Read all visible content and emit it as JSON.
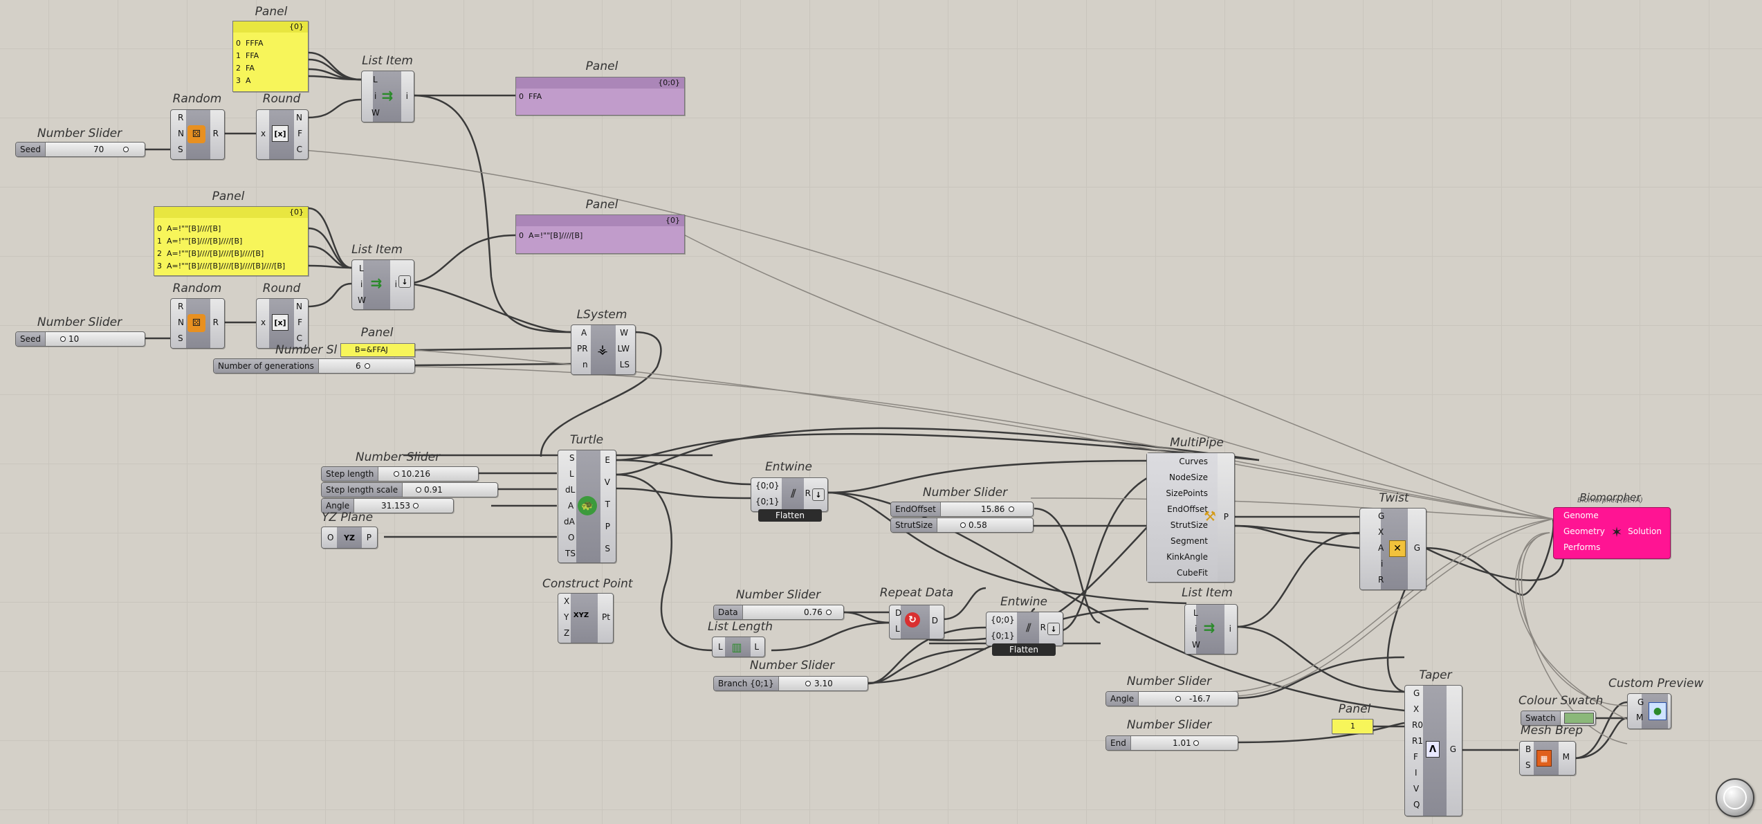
{
  "panel_fixa": {
    "title": "Panel",
    "path": "{0}",
    "lines": [
      {
        "i": "0",
        "v": "FFFA"
      },
      {
        "i": "1",
        "v": "FFA"
      },
      {
        "i": "2",
        "v": "FA"
      },
      {
        "i": "3",
        "v": "A"
      }
    ]
  },
  "panel_rules": {
    "title": "Panel",
    "path": "{0}",
    "lines": [
      {
        "i": "0",
        "v": "A=!\"\"[B]////[B]"
      },
      {
        "i": "1",
        "v": "A=!\"\"[B]////[B]////[B]"
      },
      {
        "i": "2",
        "v": "A=!\"\"[B]////[B]////[B]////[B]"
      },
      {
        "i": "3",
        "v": "A=!\"\"[B]////[B]////[B]////[B]////[B]"
      }
    ]
  },
  "panel_out1": {
    "title": "Panel",
    "path": "{0;0}",
    "lines": [
      {
        "i": "0",
        "v": "FFA"
      }
    ]
  },
  "panel_out2": {
    "title": "Panel",
    "path": "{0}",
    "lines": [
      {
        "i": "0",
        "v": "A=!\"\"[B]////[B]"
      }
    ]
  },
  "panel_b": {
    "title": "Panel",
    "value": "B=&FFAJ"
  },
  "panel_one": {
    "title": "Panel",
    "value": "1"
  },
  "random1": {
    "title": "Random",
    "in": [
      "R",
      "N",
      "S"
    ],
    "out": [
      "R"
    ]
  },
  "random2": {
    "title": "Random",
    "in": [
      "R",
      "N",
      "S"
    ],
    "out": [
      "R"
    ]
  },
  "round1": {
    "title": "Round",
    "in": [
      "x"
    ],
    "out": [
      "N",
      "F",
      "C"
    ],
    "icon": "[x]"
  },
  "round2": {
    "title": "Round",
    "in": [
      "x"
    ],
    "out": [
      "N",
      "F",
      "C"
    ],
    "icon": "[x]"
  },
  "listitem1": {
    "title": "List Item",
    "in": [
      "L",
      "i",
      "W"
    ],
    "out": [
      "i"
    ]
  },
  "listitem2": {
    "title": "List Item",
    "in": [
      "L",
      "i",
      "W"
    ],
    "out": [
      "i"
    ]
  },
  "listitem3": {
    "title": "List Item",
    "in": [
      "L",
      "i",
      "W"
    ],
    "out": [
      "i"
    ]
  },
  "lsystem": {
    "title": "LSystem",
    "in": [
      "A",
      "PR",
      "n"
    ],
    "out": [
      "W",
      "LW",
      "LS"
    ]
  },
  "turtle": {
    "title": "Turtle",
    "in": [
      "S",
      "L",
      "dL",
      "A",
      "dA",
      "O",
      "TS"
    ],
    "out": [
      "E",
      "V",
      "T",
      "P",
      "S"
    ]
  },
  "entwine1": {
    "title": "Entwine",
    "in": [
      "{0;0}",
      "{0;1}"
    ],
    "out": [
      "R"
    ],
    "badge": "Flatten"
  },
  "entwine2": {
    "title": "Entwine",
    "in": [
      "{0;0}",
      "{0;1}"
    ],
    "out": [
      "R"
    ],
    "badge": "Flatten"
  },
  "construct_point": {
    "title": "Construct Point",
    "in": [
      "X",
      "Y",
      "Z"
    ],
    "out": [
      "Pt"
    ],
    "icon": "XYZ"
  },
  "yz_plane": {
    "title": "YZ Plane",
    "in": [
      "O"
    ],
    "out": [
      "P"
    ],
    "icon": "YZ"
  },
  "repeat_data": {
    "title": "Repeat Data",
    "in": [
      "D",
      "L"
    ],
    "out": [
      "D"
    ]
  },
  "list_length": {
    "title": "List Length",
    "in": [
      "L"
    ],
    "out": [
      "L"
    ]
  },
  "multipipe": {
    "title": "MultiPipe",
    "in": [
      "Curves",
      "NodeSize",
      "SizePoints",
      "EndOffset",
      "StrutSize",
      "Segment",
      "KinkAngle",
      "CubeFit"
    ],
    "out": [
      "P"
    ]
  },
  "twist": {
    "title": "Twist",
    "in": [
      "G",
      "X",
      "A",
      "i",
      "R"
    ],
    "out": [
      "G"
    ]
  },
  "taper": {
    "title": "Taper",
    "in": [
      "G",
      "X",
      "R0",
      "R1",
      "F",
      "I",
      "V",
      "Q"
    ],
    "out": [
      "G"
    ]
  },
  "galapagos": {
    "title": "Biomorpher",
    "subtitle": "Biomorpher (BETA)",
    "in": [
      "Genome",
      "Geometry",
      "Performs"
    ],
    "out": [
      "Solution"
    ]
  },
  "colour_swatch": {
    "title": "Colour Swatch",
    "label": "Swatch",
    "color": "#8bb87a"
  },
  "custom_preview": {
    "title": "Custom Preview",
    "in": [
      "G",
      "M"
    ]
  },
  "mesh_brep": {
    "title": "Mesh Brep",
    "in": [
      "B",
      "S"
    ],
    "out": [
      "M"
    ]
  },
  "sliders": {
    "seed1": {
      "title": "Number Slider",
      "label": "Seed",
      "value": "70"
    },
    "seed2": {
      "title": "Number Slider",
      "label": "Seed",
      "value": "10"
    },
    "generations": {
      "title": "Number Slider",
      "label": "Number of generations",
      "value": "6"
    },
    "step_length": {
      "title": "Number Slider",
      "label": "Step length",
      "value": "10.216"
    },
    "step_scale": {
      "title": "",
      "label": "Step length scale",
      "value": "0.91"
    },
    "angle1": {
      "title": "",
      "label": "Angle",
      "value": "31.153"
    },
    "endoffset": {
      "title": "Number Slider",
      "label": "EndOffset",
      "value": "15.86"
    },
    "strutsize": {
      "title": "",
      "label": "StrutSize",
      "value": "0.58"
    },
    "data": {
      "title": "Number Slider",
      "label": "Data",
      "value": "0.76"
    },
    "branch": {
      "title": "Number Slider",
      "label": "Branch {0;1}",
      "value": "3.10"
    },
    "angle2": {
      "title": "Number Slider",
      "label": "Angle",
      "value": "-16.7"
    },
    "end": {
      "title": "Number Slider",
      "label": "End",
      "value": "1.01"
    }
  },
  "colors": {
    "canvas": "#d4d0c8",
    "panel_yellow": "#f7f55a",
    "panel_purple": "#c19ccb",
    "biomorpher": "#ff1493",
    "wire": "#3a3a3a"
  }
}
